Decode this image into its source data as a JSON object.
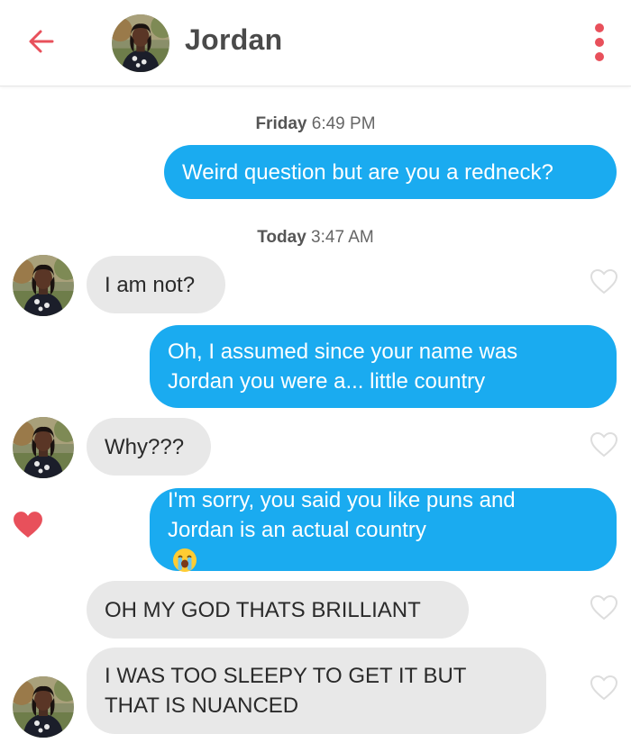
{
  "header": {
    "contact_name": "Jordan",
    "back_icon": "arrow-left-icon",
    "menu_icon": "more-vertical-icon",
    "accent_color": "#e8505b"
  },
  "colors": {
    "outgoing_bubble": "#1aabf0",
    "incoming_bubble": "#e8e8e8",
    "heart_liked": "#e8505b",
    "heart_outline": "#dddddd"
  },
  "conversation": {
    "timestamp_1": {
      "day": "Friday",
      "time": "6:49 PM"
    },
    "msg_1": {
      "sender": "me",
      "lines": [
        "Weird question but are you a redneck?"
      ]
    },
    "timestamp_2": {
      "day": "Today",
      "time": "3:47 AM"
    },
    "msg_2": {
      "sender": "Jordan",
      "lines": [
        "I am not?"
      ]
    },
    "msg_3": {
      "sender": "me",
      "lines": [
        "Oh, I assumed since your name was",
        "Jordan you were a... little country"
      ]
    },
    "msg_4": {
      "sender": "Jordan",
      "lines": [
        "Why???"
      ]
    },
    "msg_5": {
      "sender": "me",
      "lines": [
        "I'm sorry, you said you like puns and",
        "Jordan is an actual country"
      ],
      "emoji": "loudly-crying-face-emoji",
      "liked": true
    },
    "msg_6": {
      "sender": "Jordan",
      "lines": [
        "OH MY GOD THATS BRILLIANT"
      ]
    },
    "msg_7": {
      "sender": "Jordan",
      "lines": [
        "I WAS TOO SLEEPY TO GET IT BUT",
        "THAT IS NUANCED"
      ]
    }
  }
}
